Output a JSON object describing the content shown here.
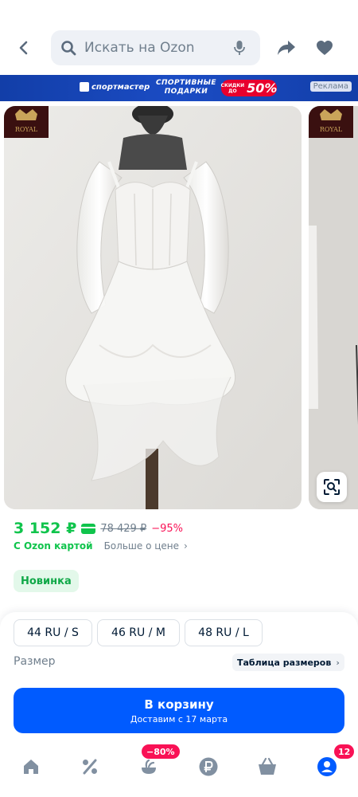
{
  "header": {
    "search_placeholder": "Искать на Ozon",
    "icons": {
      "back": "chevron-left-icon",
      "search": "search-icon",
      "mic": "microphone-icon",
      "share": "share-icon",
      "favorite": "heart-icon"
    }
  },
  "banner": {
    "brand": "спортмастер",
    "text_line1": "СПОРТИВНЫЕ",
    "text_line2": "ПОДАРКИ",
    "pill_small_line1": "СКИДКИ",
    "pill_small_line2": "ДО",
    "pill_big": "50%",
    "ad_label": "Реклама"
  },
  "gallery": {
    "logo_text": "ROYAL",
    "visual_search_icon": "visual-search-icon"
  },
  "price": {
    "current": "3 152 ₽",
    "old": "78 429 ₽",
    "discount": "−95%",
    "ozon_card_label": "С Ozon картой",
    "more_price_label": "Больше о цене",
    "more_price_chevron": "›"
  },
  "badge": {
    "label": "Новинка"
  },
  "sizes": {
    "options": [
      "44 RU / S",
      "46 RU / M",
      "48 RU / L"
    ],
    "label": "Размер",
    "table_label": "Таблица размеров",
    "table_chevron": "›"
  },
  "cart": {
    "title": "В корзину",
    "subtitle": "Доставим с 17 марта"
  },
  "bottom_nav": {
    "items": [
      {
        "icon": "home-icon"
      },
      {
        "icon": "percent-icon"
      },
      {
        "icon": "fresh-icon",
        "badge": "−80%"
      },
      {
        "icon": "ruble-icon"
      },
      {
        "icon": "cart-icon"
      },
      {
        "icon": "profile-icon",
        "badge": "12"
      }
    ]
  },
  "colors": {
    "accent": "#005bff",
    "price_green": "#10c44c",
    "discount_pink": "#f91155",
    "banner_blue": "#123ea8"
  }
}
